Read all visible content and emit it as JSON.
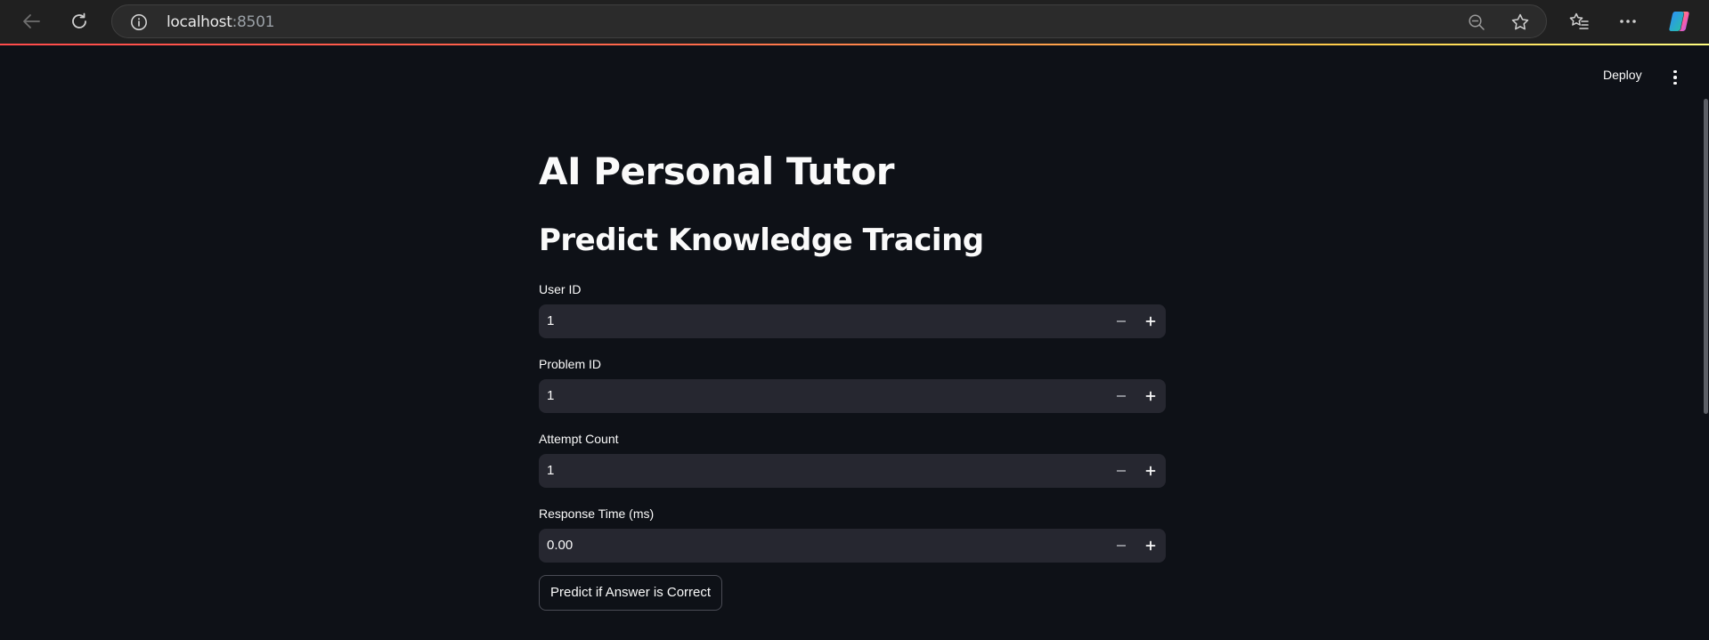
{
  "browser": {
    "url_host": "localhost",
    "url_port": ":8501"
  },
  "app": {
    "deploy_label": "Deploy",
    "title": "AI Personal Tutor",
    "subtitle": "Predict Knowledge Tracing",
    "fields": [
      {
        "label": "User ID",
        "value": "1"
      },
      {
        "label": "Problem ID",
        "value": "1"
      },
      {
        "label": "Attempt Count",
        "value": "1"
      },
      {
        "label": "Response Time (ms)",
        "value": "0.00"
      }
    ],
    "predict_button": "Predict if Answer is Correct"
  },
  "colors": {
    "background": "#0e1117",
    "input_bg": "#262730",
    "text": "#fafafa",
    "accent": "#ff4b4b"
  }
}
